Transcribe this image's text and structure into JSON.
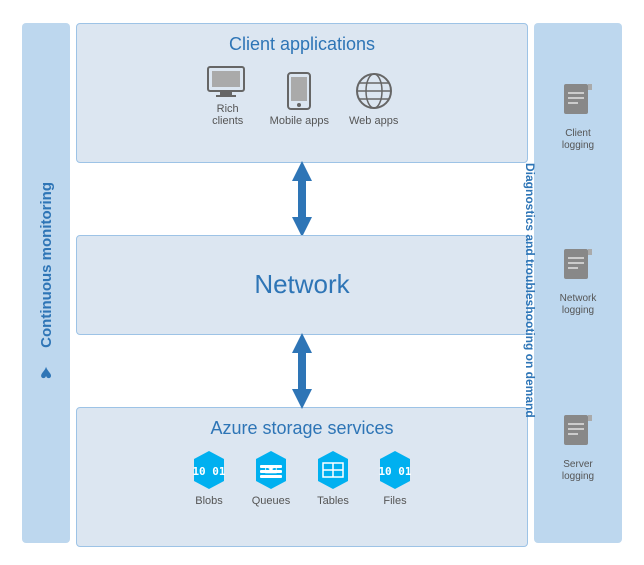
{
  "leftSidebar": {
    "label": "Continuous monitoring"
  },
  "rightSidebar": {
    "label": "Diagnostics and troubleshooting on demand",
    "items": [
      {
        "label": "Client\nlogging",
        "id": "client-logging"
      },
      {
        "label": "Network\nlogging",
        "id": "network-logging"
      },
      {
        "label": "Server\nlogging",
        "id": "server-logging"
      }
    ]
  },
  "clientApps": {
    "title": "Client applications",
    "icons": [
      {
        "label": "Rich\nclients",
        "id": "rich-clients"
      },
      {
        "label": "Mobile apps",
        "id": "mobile-apps"
      },
      {
        "label": "Web apps",
        "id": "web-apps"
      }
    ]
  },
  "network": {
    "title": "Network"
  },
  "storage": {
    "title": "Azure storage services",
    "icons": [
      {
        "label": "Blobs",
        "id": "blobs"
      },
      {
        "label": "Queues",
        "id": "queues"
      },
      {
        "label": "Tables",
        "id": "tables"
      },
      {
        "label": "Files",
        "id": "files"
      }
    ]
  }
}
